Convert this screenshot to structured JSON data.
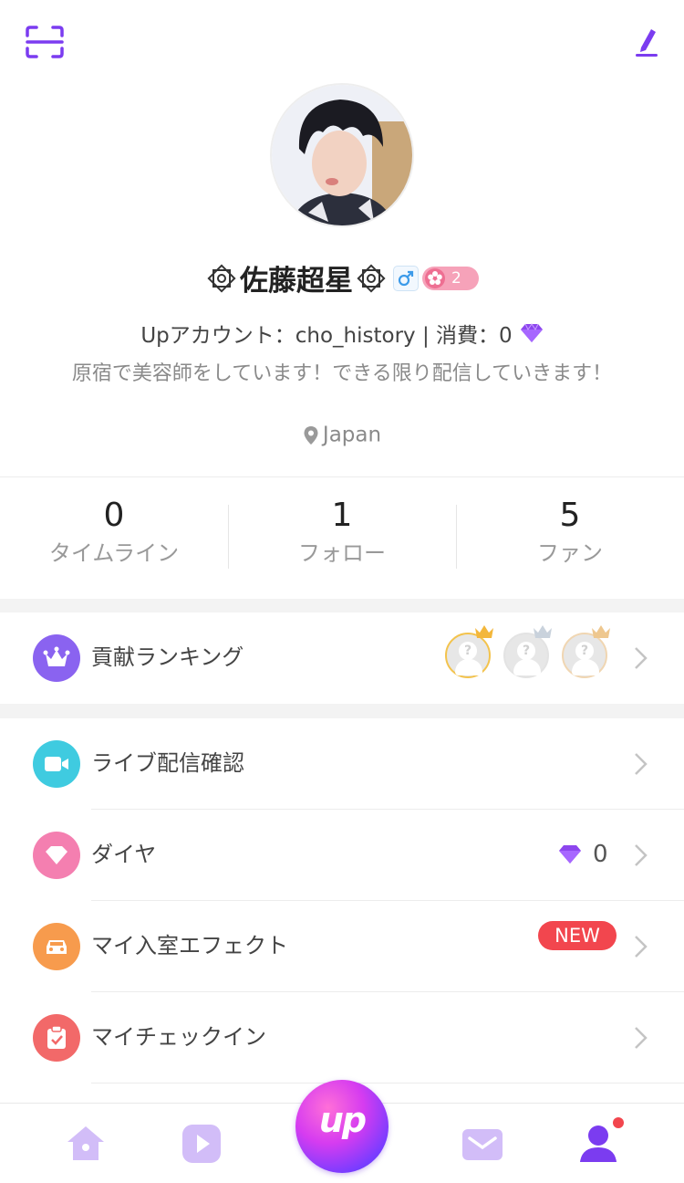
{
  "header": {
    "scan_icon": "scan-icon",
    "edit_icon": "edit-pencil-icon"
  },
  "profile": {
    "name": "佐藤超星",
    "gender_symbol": "♂",
    "level": "2",
    "account_text": "Upアカウント：cho_history | 消費：0",
    "bio": "原宿で美容師をしています！できる限り配信していきます！",
    "location": "Japan"
  },
  "stats": [
    {
      "value": "0",
      "label": "タイムライン"
    },
    {
      "value": "1",
      "label": "フォロー"
    },
    {
      "value": "5",
      "label": "ファン"
    }
  ],
  "menu": {
    "ranking": {
      "label": "貢献ランキング",
      "icon": "crown-icon",
      "color": "#8a63f0"
    },
    "live": {
      "label": "ライブ配信確認",
      "icon": "video-camera-icon",
      "color": "#3fcbe0"
    },
    "diamond": {
      "label": "ダイヤ",
      "icon": "diamond-icon",
      "color": "#f47fb0",
      "value": "0"
    },
    "effect": {
      "label": "マイ入室エフェクト",
      "icon": "car-icon",
      "color": "#f79b4d",
      "badge": "NEW"
    },
    "checkin": {
      "label": "マイチェックイン",
      "icon": "clipboard-check-icon",
      "color": "#f26969"
    }
  },
  "tabbar": {
    "center_label": "up",
    "tabs": [
      "home-icon",
      "play-icon",
      "up-icon",
      "mail-icon",
      "profile-icon"
    ],
    "accent": "#7b3cf0"
  }
}
